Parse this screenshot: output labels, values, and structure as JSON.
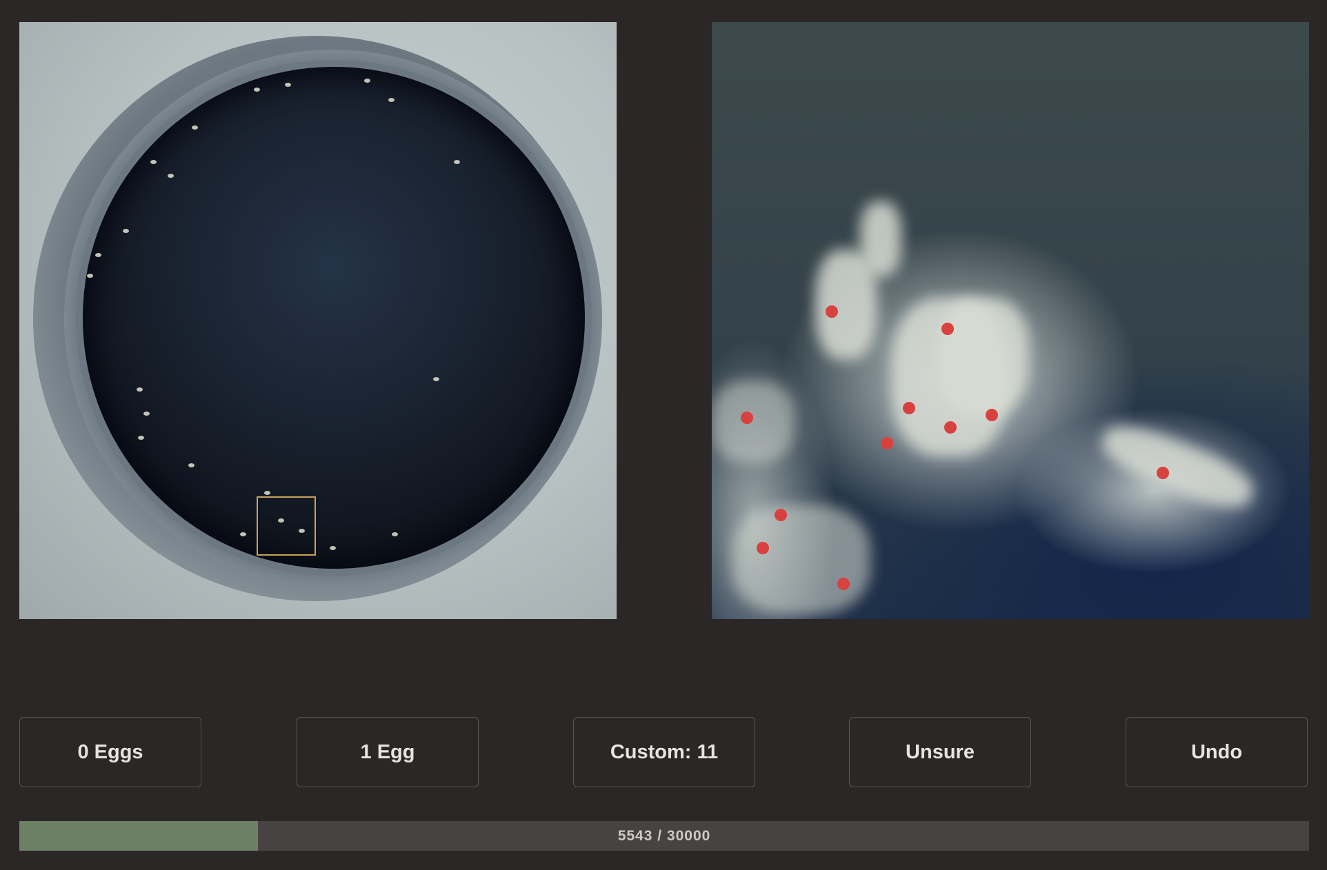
{
  "left_image": {
    "alt": "Full well scan with egg specks; selection box marks zoomed region"
  },
  "right_image": {
    "alt": "Zoomed crop of the selected region with eggs marked by red dots",
    "marker_color": "#d8413d"
  },
  "buttons": [
    {
      "label": "0 Eggs"
    },
    {
      "label": "1 Egg"
    },
    {
      "label": "Custom: 11"
    },
    {
      "label": "Unsure"
    },
    {
      "label": "Undo"
    }
  ],
  "progress": {
    "current": 5543,
    "total": 30000,
    "text": "5543 / 30000",
    "fraction": 0.1848
  },
  "colors": {
    "background": "#2b2727",
    "button_border": "#5a5555",
    "progress_fill": "#6c8066",
    "progress_track": "#484343",
    "selection_box": "#c9a15a"
  }
}
